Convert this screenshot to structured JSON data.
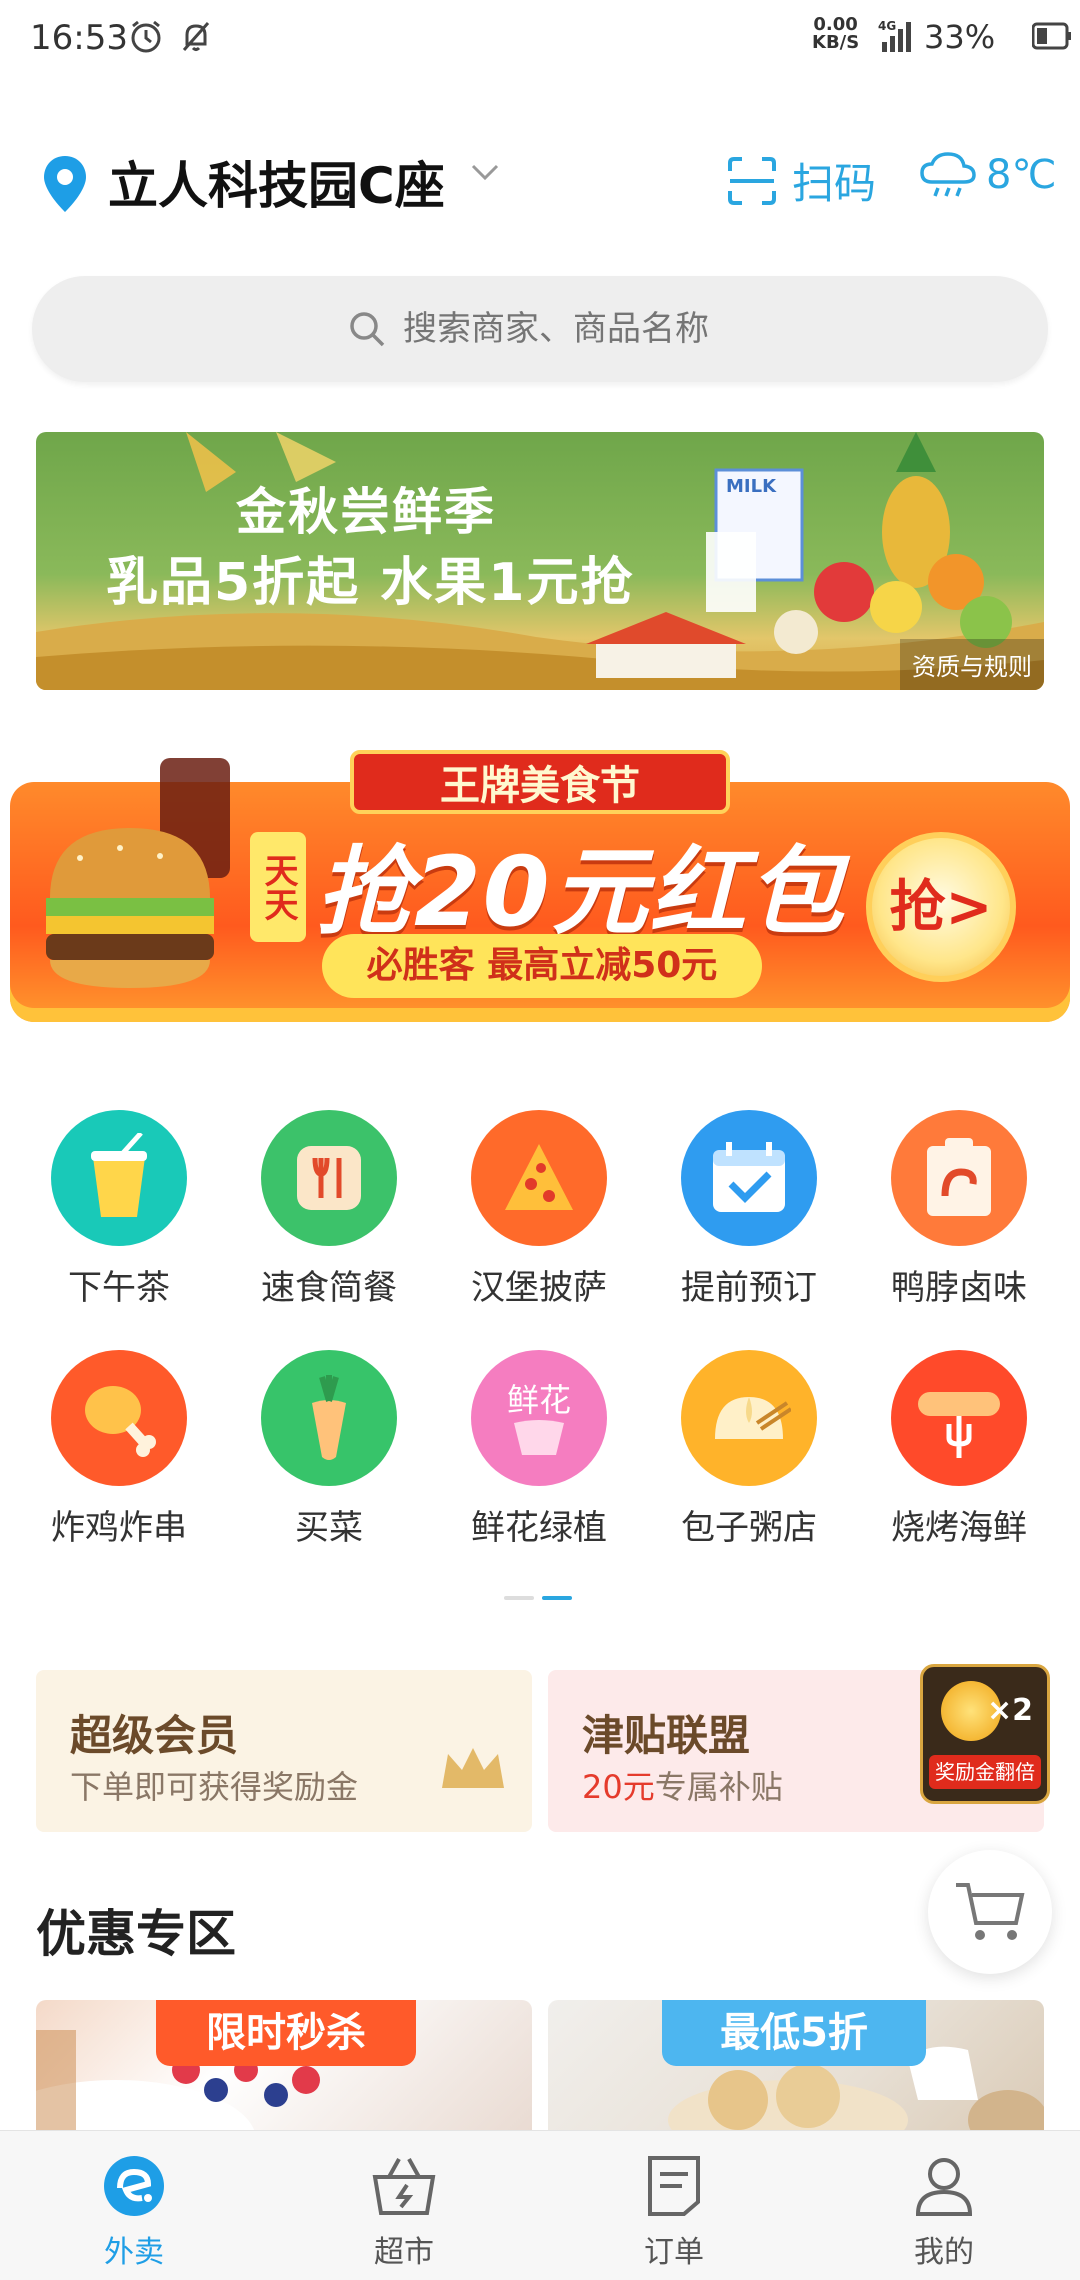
{
  "status_bar": {
    "time": "16:53",
    "net_speed_value": "0.00",
    "net_speed_unit": "KB/S",
    "network_type": "4G",
    "battery": "33%"
  },
  "header": {
    "location": "立人科技园C座",
    "scan_label": "扫码",
    "temperature": "8℃",
    "accent_color": "#2aa6e0"
  },
  "search": {
    "placeholder": "搜索商家、商品名称"
  },
  "banner_autumn": {
    "line1": "金秋尝鲜季",
    "line2": "乳品5折起  水果1元抢",
    "tag": "资质与规则"
  },
  "banner_festival": {
    "top_label": "王牌美食节",
    "day_label": "天天",
    "main_text": "抢20元红包",
    "sub_text": "必胜客 最高立减50元",
    "button_label": "抢>"
  },
  "categories": [
    {
      "label": "下午茶",
      "icon": "drink-cup-icon",
      "color": "#19c9b8"
    },
    {
      "label": "速食简餐",
      "icon": "fast-food-icon",
      "color": "#3cc26a"
    },
    {
      "label": "汉堡披萨",
      "icon": "pizza-icon",
      "color": "#ff6a2a"
    },
    {
      "label": "提前预订",
      "icon": "calendar-check-icon",
      "color": "#2f9cf0"
    },
    {
      "label": "鸭脖卤味",
      "icon": "duck-neck-icon",
      "color": "#ff7a3a"
    },
    {
      "label": "炸鸡炸串",
      "icon": "fried-chicken-icon",
      "color": "#ff5a2a"
    },
    {
      "label": "买菜",
      "icon": "carrot-icon",
      "color": "#37c46a"
    },
    {
      "label": "鲜花绿植",
      "icon": "flower-icon",
      "color": "#f57dc0"
    },
    {
      "label": "包子粥店",
      "icon": "bun-icon",
      "color": "#ffb32a"
    },
    {
      "label": "烧烤海鲜",
      "icon": "bbq-icon",
      "color": "#ff4a2a"
    }
  ],
  "promos": {
    "vip": {
      "title": "超级会员",
      "subtitle": "下单即可获得奖励金"
    },
    "alliance": {
      "title": "津贴联盟",
      "amount": "20元",
      "subtitle_rest": "专属补贴",
      "badge_multiplier": "×2",
      "badge_label": "奖励金翻倍"
    }
  },
  "section": {
    "title": "优惠专区",
    "deals": [
      {
        "tag": "限时秒杀"
      },
      {
        "tag": "最低5折"
      }
    ]
  },
  "bottom_nav": [
    {
      "label": "外卖",
      "icon": "ele-logo-icon",
      "active": true
    },
    {
      "label": "超市",
      "icon": "basket-icon",
      "active": false
    },
    {
      "label": "订单",
      "icon": "order-list-icon",
      "active": false
    },
    {
      "label": "我的",
      "icon": "user-icon",
      "active": false
    }
  ]
}
